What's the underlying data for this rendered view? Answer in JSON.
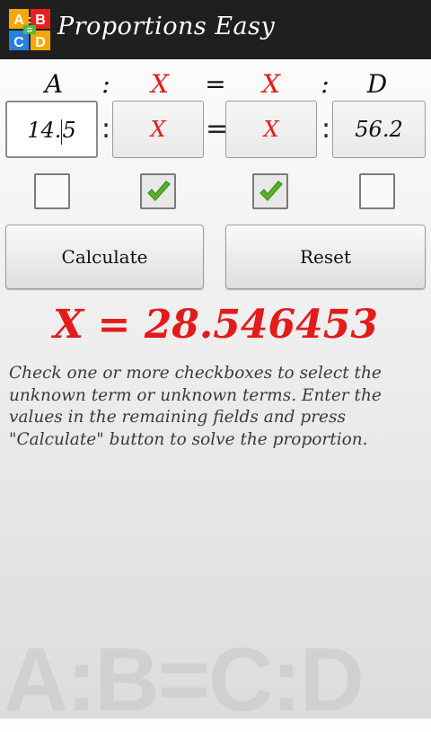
{
  "app": {
    "title": "Proportions Easy",
    "icon_letters": {
      "a": "A",
      "b": "B",
      "c": "C",
      "d": "D",
      "colon": ":",
      "equals": "="
    }
  },
  "headers": [
    "A",
    ":",
    "X",
    "=",
    "X",
    ":",
    "D"
  ],
  "fields": {
    "a": {
      "value_before_caret": "14.",
      "value_after_caret": "5"
    },
    "b": {
      "value": "X"
    },
    "c": {
      "value": "X"
    },
    "d": {
      "value": "56.2"
    }
  },
  "separators": [
    ":",
    "=",
    ":"
  ],
  "checkboxes": [
    {
      "checked": false
    },
    {
      "checked": true
    },
    {
      "checked": true
    },
    {
      "checked": false
    }
  ],
  "buttons": {
    "calculate": "Calculate",
    "reset": "Reset"
  },
  "result": "X = 28.546453",
  "help_text": "Check one or more checkboxes to select the unknown term or unknown terms. Enter the values in the remaining fields and press \"Calculate\" button to solve the proportion.",
  "watermark": "A:B=C:D",
  "colors": {
    "accent_red": "#e31b1b",
    "actionbar": "#1f1f1f",
    "check_green": "#5db02a"
  }
}
